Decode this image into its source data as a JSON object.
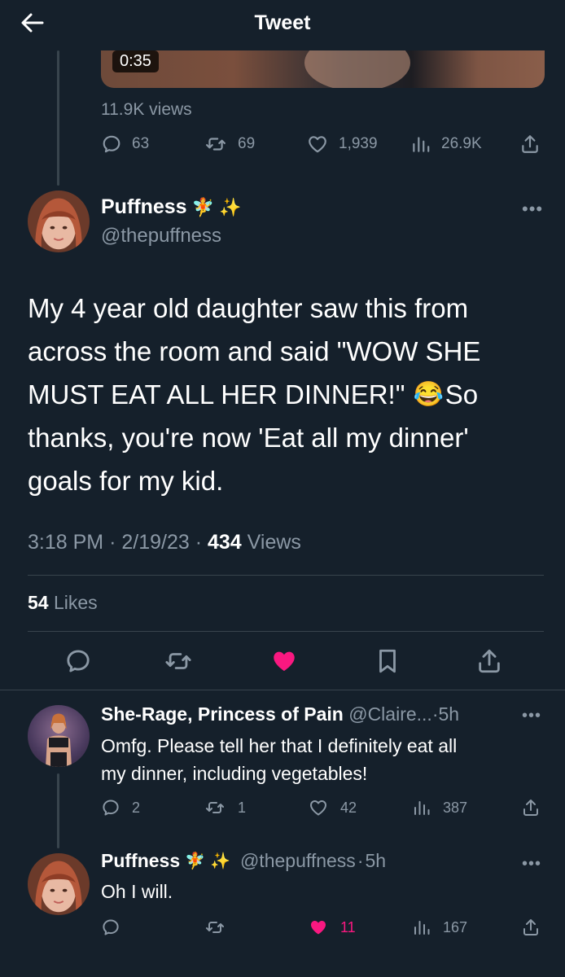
{
  "header": {
    "title": "Tweet"
  },
  "prev_tweet": {
    "video_duration": "0:35",
    "views": "11.9K views",
    "replies": "63",
    "retweets": "69",
    "likes": "1,939",
    "analytics": "26.9K"
  },
  "main_tweet": {
    "name": "Puffness",
    "handle": "@thepuffness",
    "text_lines": [
      "My 4 year old daughter saw this from",
      "across the room and said \"WOW SHE",
      "MUST EAT ALL HER DINNER!\"",
      "So",
      "thanks, you're now 'Eat all my dinner'",
      "goals for my kid."
    ],
    "time": "3:18 PM",
    "date": "2/19/23",
    "views_count": "434",
    "views_label": "Views",
    "likes_count": "54",
    "likes_label": "Likes",
    "sep": "·"
  },
  "reply1": {
    "name": "She-Rage, Princess of Pain",
    "handle": "@Claire...",
    "time": "5h",
    "text_line1": "Omfg. Please tell her that I definitely eat all",
    "text_line2": "my dinner, including vegetables!",
    "replies": "2",
    "retweets": "1",
    "likes": "42",
    "analytics": "387"
  },
  "reply2": {
    "name": "Puffness",
    "handle": "@thepuffness",
    "time": "5h",
    "text": "Oh I will.",
    "likes": "11",
    "analytics": "167"
  },
  "icons": [
    "back-arrow-icon",
    "reply-icon",
    "retweet-icon",
    "heart-icon",
    "analytics-icon",
    "share-icon",
    "bookmark-icon",
    "more-icon",
    "fairy-emoji-icon",
    "sparkles-emoji-icon",
    "laughing-emoji-icon"
  ],
  "colors": {
    "background": "#15202b",
    "text": "#ffffff",
    "secondary": "#8b98a5",
    "divider": "#38444d",
    "like": "#f91880"
  }
}
